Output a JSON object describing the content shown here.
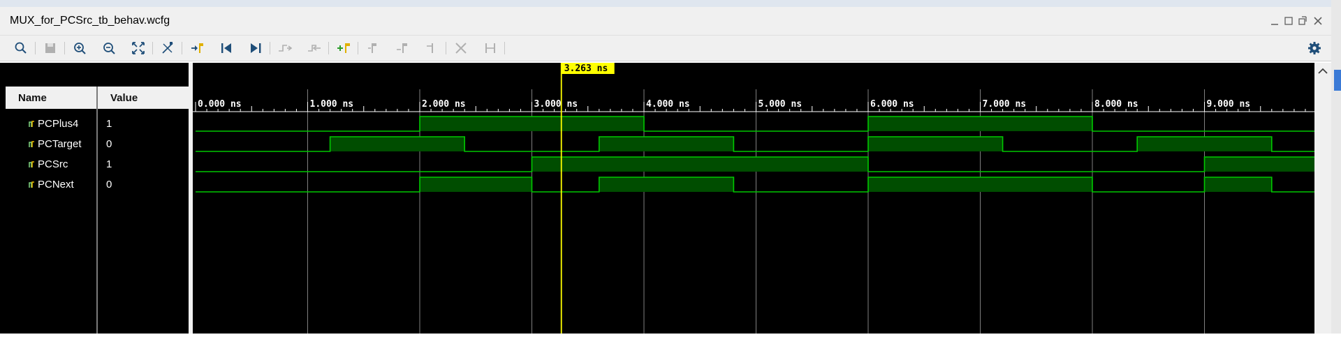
{
  "window": {
    "title": "MUX_for_PCSrc_tb_behav.wcfg",
    "controls": [
      "minimize-icon",
      "restore-icon",
      "float-icon",
      "close-icon"
    ]
  },
  "toolbar": {
    "buttons": [
      {
        "name": "search-icon",
        "enabled": true
      },
      {
        "name": "save-icon",
        "enabled": false
      },
      {
        "name": "zoom-in-icon",
        "enabled": true
      },
      {
        "name": "zoom-out-icon",
        "enabled": true
      },
      {
        "name": "zoom-fit-icon",
        "enabled": true
      },
      {
        "name": "cursor-to-zero-icon",
        "enabled": true
      },
      {
        "name": "go-to-time-zero-icon",
        "enabled": true
      },
      {
        "name": "go-to-last-time-icon",
        "enabled": true
      },
      {
        "name": "previous-transition-icon",
        "enabled": false
      },
      {
        "name": "next-transition-icon",
        "enabled": false
      },
      {
        "name": "add-marker-icon",
        "enabled": true
      },
      {
        "name": "previous-marker-icon",
        "enabled": false
      },
      {
        "name": "next-marker-icon",
        "enabled": false
      },
      {
        "name": "swap-cursors-icon",
        "enabled": false
      },
      {
        "name": "delete-marker-icon",
        "enabled": false
      },
      {
        "name": "snap-to-transition-icon",
        "enabled": false
      }
    ],
    "settings_icon": "gear-icon"
  },
  "objects": {
    "name_header": "Name",
    "value_header": "Value",
    "signals": [
      {
        "name": "PCPlus4",
        "value": "1",
        "transitions": [
          [
            0,
            0
          ],
          [
            2,
            1
          ],
          [
            4,
            0
          ],
          [
            6,
            1
          ],
          [
            8,
            0
          ]
        ]
      },
      {
        "name": "PCTarget",
        "value": "0",
        "transitions": [
          [
            0,
            0
          ],
          [
            1.2,
            1
          ],
          [
            2.4,
            0
          ],
          [
            3.6,
            1
          ],
          [
            4.8,
            0
          ],
          [
            6,
            1
          ],
          [
            7.2,
            0
          ],
          [
            8.4,
            1
          ],
          [
            9.6,
            0
          ]
        ]
      },
      {
        "name": "PCSrc",
        "value": "1",
        "transitions": [
          [
            0,
            0
          ],
          [
            3,
            1
          ],
          [
            6,
            0
          ],
          [
            9,
            1
          ]
        ]
      },
      {
        "name": "PCNext",
        "value": "0",
        "transitions": [
          [
            0,
            0
          ],
          [
            2,
            1
          ],
          [
            3,
            0
          ],
          [
            3.6,
            1
          ],
          [
            4.8,
            0
          ],
          [
            6,
            1
          ],
          [
            8,
            0
          ],
          [
            9,
            1
          ],
          [
            9.6,
            0
          ]
        ]
      }
    ]
  },
  "timeline": {
    "cursor": "3.263 ns",
    "cursor_time": 3.263,
    "tick_labels": [
      "0.000 ns",
      "1.000 ns",
      "2.000 ns",
      "3.000 ns",
      "4.000 ns",
      "5.000 ns",
      "6.000 ns",
      "7.000 ns",
      "8.000 ns",
      "9.000 ns"
    ],
    "tick_values": [
      0,
      1,
      2,
      3,
      4,
      5,
      6,
      7,
      8,
      9
    ],
    "view_end": 10.0
  },
  "colors": {
    "waveform": "#00c800",
    "waveform_fill": "#004d00",
    "cursor": "#ffff00",
    "background": "#000000",
    "gridline": "#808080"
  }
}
